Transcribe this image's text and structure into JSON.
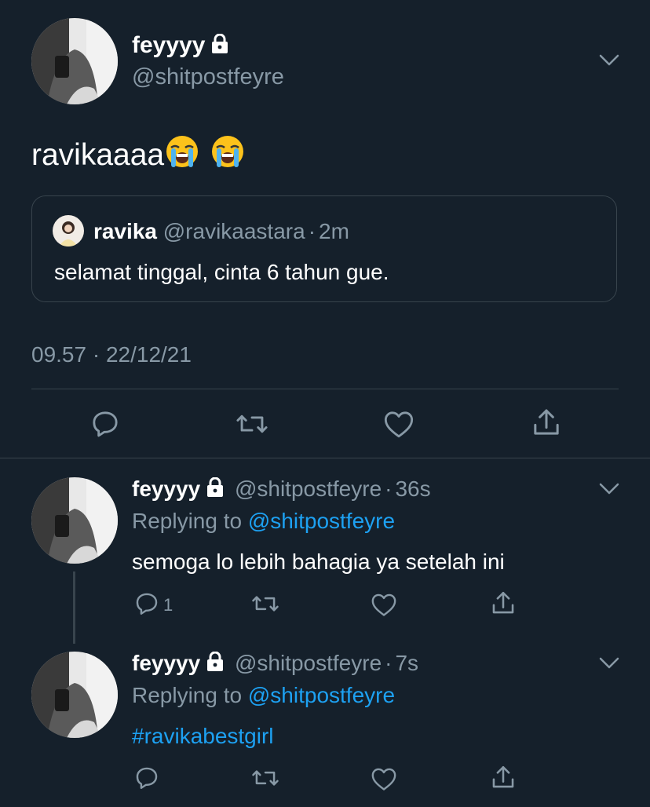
{
  "main_tweet": {
    "display_name": "feyyyy",
    "handle": "@shitpostfeyre",
    "text": "ravikaaaa",
    "emoji": [
      "loudly-crying-face",
      "loudly-crying-face"
    ],
    "timestamp": "09.57 · 22/12/21"
  },
  "quoted_tweet": {
    "display_name": "ravika",
    "handle": "@ravikaastara",
    "separator": "·",
    "time": "2m",
    "text": "selamat tinggal, cinta 6 tahun gue."
  },
  "replies": [
    {
      "display_name": "feyyyy",
      "handle": "@shitpostfeyre",
      "separator": "·",
      "time": "36s",
      "replying_prefix": "Replying to",
      "replying_handle": "@shitpostfeyre",
      "text": "semoga lo lebih bahagia ya setelah ini",
      "reply_count": "1"
    },
    {
      "display_name": "feyyyy",
      "handle": "@shitpostfeyre",
      "separator": "·",
      "time": "7s",
      "replying_prefix": "Replying to",
      "replying_handle": "@shitpostfeyre",
      "text": "#ravikabestgirl"
    }
  ],
  "icons": [
    "lock-icon",
    "chevron-down-icon",
    "reply-icon",
    "retweet-icon",
    "like-icon",
    "share-icon"
  ],
  "colors": {
    "background": "#15202b",
    "muted": "#8899a6",
    "link": "#1da1f2",
    "divider": "#38444d"
  }
}
